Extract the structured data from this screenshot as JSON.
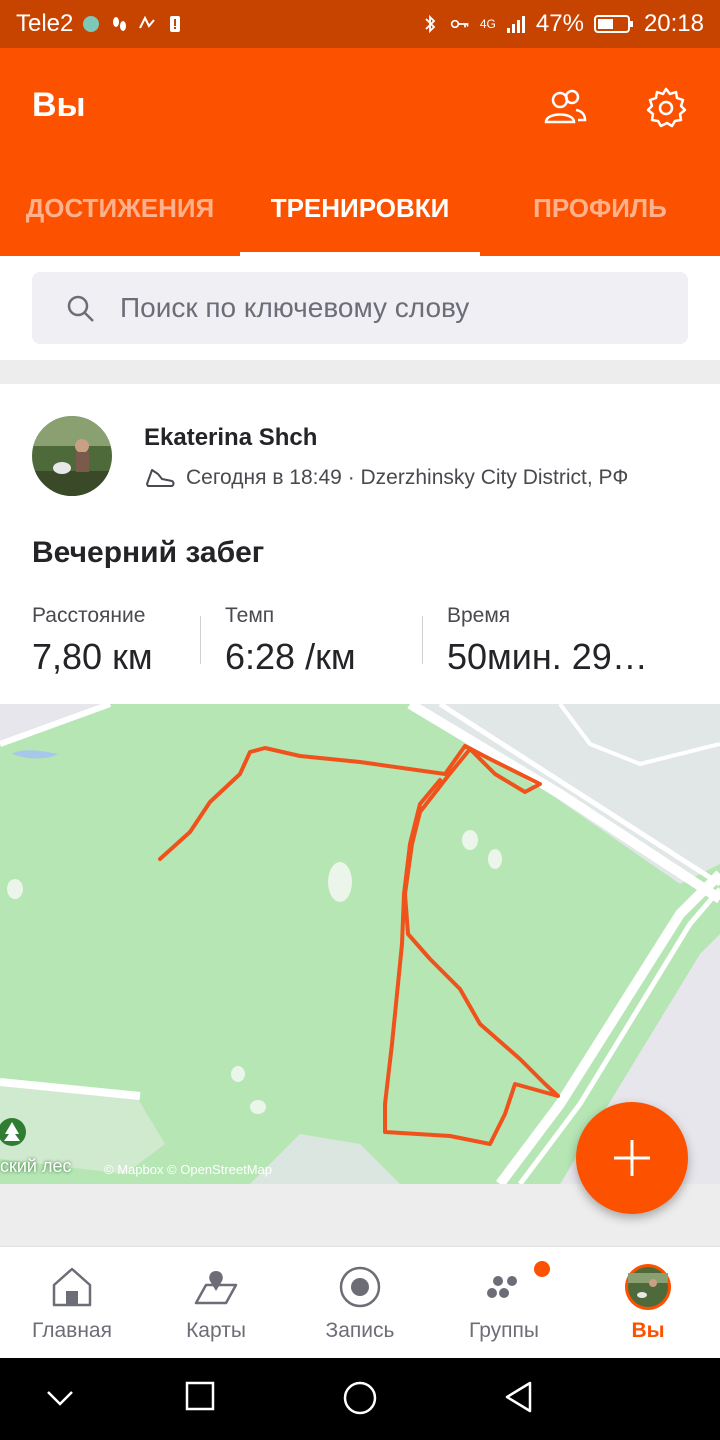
{
  "status_bar": {
    "carrier": "Tele2",
    "battery": "47%",
    "time": "20:18",
    "network": "4G"
  },
  "header": {
    "title": "Вы",
    "icons": [
      "people-icon",
      "gear-icon"
    ]
  },
  "tabs": [
    {
      "label": "ДОСТИЖЕНИЯ",
      "active": false
    },
    {
      "label": "ТРЕНИРОВКИ",
      "active": true
    },
    {
      "label": "ПРОФИЛЬ",
      "active": false
    }
  ],
  "search": {
    "placeholder": "Поиск по ключевому слову"
  },
  "activity": {
    "athlete": "Ekaterina Shch",
    "meta": "Сегодня в 18:49 · Dzerzhinsky City District, РФ",
    "title": "Вечерний забег",
    "stats": [
      {
        "label": "Расстояние",
        "value": "7,80 км"
      },
      {
        "label": "Темп",
        "value": "6:28 /км"
      },
      {
        "label": "Время",
        "value": "50мин. 29…"
      }
    ],
    "map": {
      "place_label": "ский лес",
      "attribution": "© Mapbox © OpenStreetMap"
    }
  },
  "fab": {
    "icon": "plus-icon"
  },
  "bottom_nav": [
    {
      "label": "Главная",
      "icon": "home-icon",
      "active": false
    },
    {
      "label": "Карты",
      "icon": "map-icon",
      "active": false
    },
    {
      "label": "Запись",
      "icon": "record-icon",
      "active": false
    },
    {
      "label": "Группы",
      "icon": "groups-icon",
      "active": false
    },
    {
      "label": "Вы",
      "icon": "avatar-icon",
      "active": true
    }
  ],
  "colors": {
    "brand": "#fc5200",
    "status_bar": "#c74300",
    "route": "#f0521c",
    "map_green": "#b5e6b4"
  }
}
